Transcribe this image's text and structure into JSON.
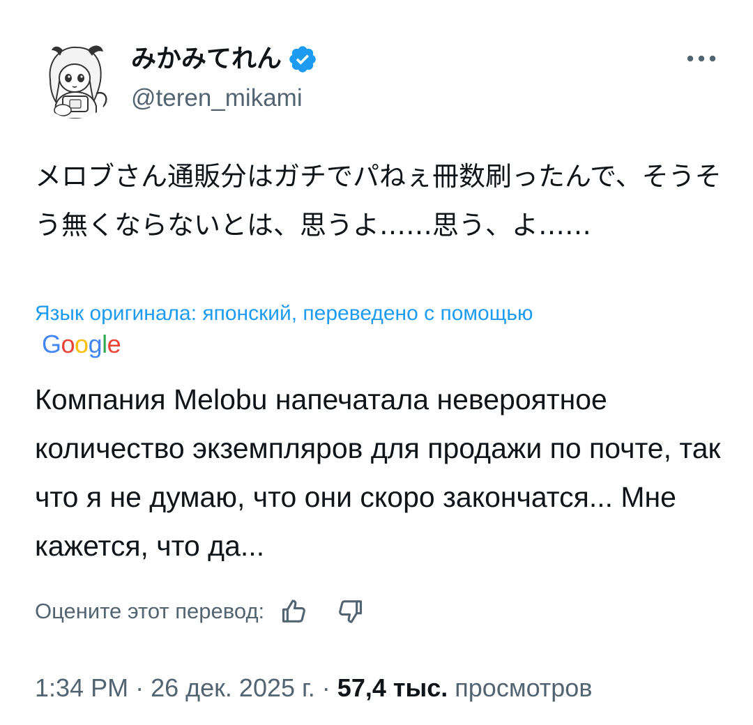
{
  "author": {
    "display_name": "みかみてれん",
    "handle": "@teren_mikami",
    "verified": true
  },
  "tweet": {
    "text": "メロブさん通販分はガチでパねぇ冊数刷ったんで、そうそう無くならないとは、思うよ……思う、よ……",
    "translation_note": "Язык оригинала: японский, переведено с помощью",
    "translation_provider": [
      "G",
      "o",
      "o",
      "g",
      "l",
      "e"
    ],
    "translated_text": "Компания Melobu напечатала невероятное количество экземпляров для продажи по почте, так что я не думаю, что они скоро закончатся... Мне кажется, что да...",
    "rate_label": "Оцените этот перевод:"
  },
  "meta": {
    "time": "1:34 PM",
    "date": "26 дек. 2025 г.",
    "separator": "·",
    "views_count": "57,4 тыс.",
    "views_label": "просмотров"
  },
  "icons": {
    "more": "more-options-icon",
    "verified": "verified-badge-icon",
    "thumbs_up": "thumbs-up-icon",
    "thumbs_down": "thumbs-down-icon"
  },
  "colors": {
    "accent": "#1d9bf0",
    "text_primary": "#0f1419",
    "text_secondary": "#536471",
    "google_blue": "#4285F4",
    "google_red": "#EA4335",
    "google_yellow": "#FBBC05",
    "google_green": "#34A853"
  }
}
